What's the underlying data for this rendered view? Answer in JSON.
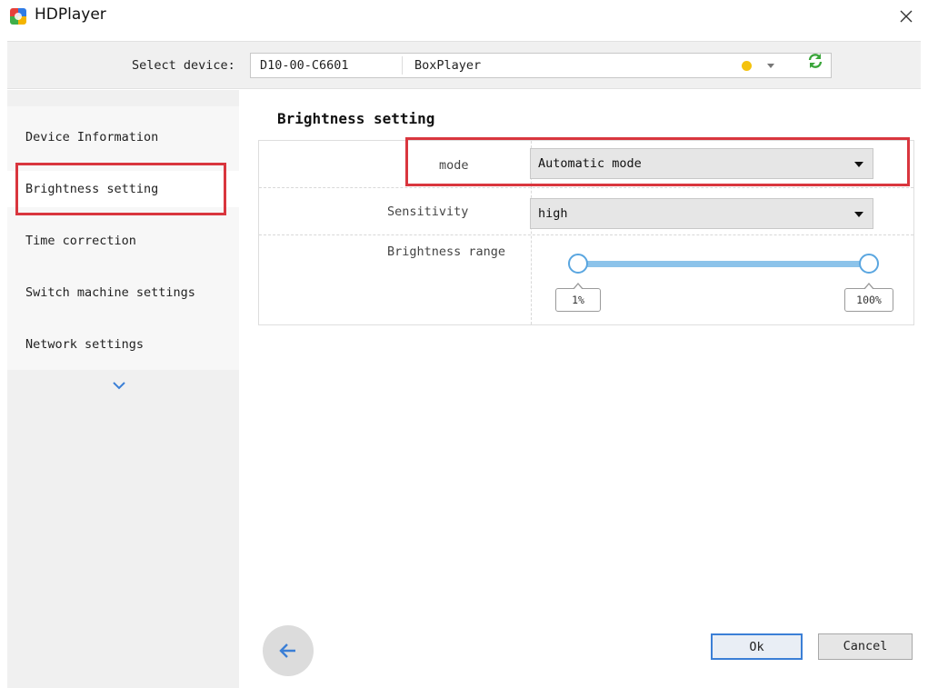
{
  "window": {
    "title": "HDPlayer"
  },
  "device_bar": {
    "label": "Select device:",
    "device_id": "D10-00-C6601",
    "device_name": "BoxPlayer",
    "status_color": "#f4c20d"
  },
  "sidebar": {
    "items": [
      {
        "label": "Device Information",
        "active": false
      },
      {
        "label": "Brightness setting",
        "active": true
      },
      {
        "label": "Time correction",
        "active": false
      },
      {
        "label": "Switch machine settings",
        "active": false
      },
      {
        "label": "Network settings",
        "active": false
      }
    ],
    "more_icon": "chevron-down-icon"
  },
  "main": {
    "title": "Brightness setting",
    "mode": {
      "label": "mode",
      "value": "Automatic mode"
    },
    "sensitivity": {
      "label": "Sensitivity",
      "value": "high"
    },
    "brightness_range": {
      "label": "Brightness range",
      "min_label": "1%",
      "max_label": "100%",
      "min": 1,
      "max": 100
    }
  },
  "footer": {
    "back_icon": "arrow-left-icon",
    "ok_label": "Ok",
    "cancel_label": "Cancel"
  },
  "colors": {
    "accent": "#5aa6e0",
    "highlight": "#d9363e",
    "refresh": "#3aa53a"
  }
}
